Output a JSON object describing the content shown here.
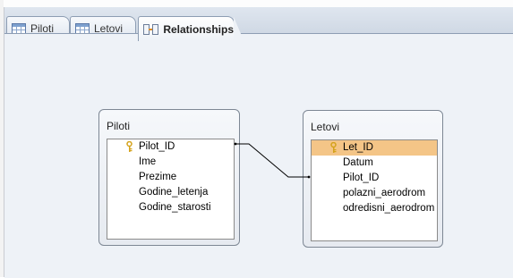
{
  "tabs": [
    {
      "label": "Piloti",
      "icon": "table-icon",
      "active": false
    },
    {
      "label": "Letovi",
      "icon": "table-icon",
      "active": false
    },
    {
      "label": "Relationships",
      "icon": "relationships-icon",
      "active": true
    }
  ],
  "tables": {
    "piloti": {
      "title": "Piloti",
      "fields": [
        {
          "name": "Pilot_ID",
          "primary_key": true
        },
        {
          "name": "Ime"
        },
        {
          "name": "Prezime"
        },
        {
          "name": "Godine_letenja"
        },
        {
          "name": "Godine_starosti"
        }
      ]
    },
    "letovi": {
      "title": "Letovi",
      "fields": [
        {
          "name": "Let_ID",
          "primary_key": true,
          "selected": true
        },
        {
          "name": "Datum"
        },
        {
          "name": "Pilot_ID"
        },
        {
          "name": "polazni_aerodrom"
        },
        {
          "name": "odredisni_aerodrom"
        }
      ]
    }
  },
  "relationship": {
    "from": "Piloti.Pilot_ID",
    "to": "Letovi.Pilot_ID"
  },
  "colors": {
    "selected_field": "#f4c587",
    "key": "#d4a21a",
    "canvas": "#eef2f7"
  }
}
